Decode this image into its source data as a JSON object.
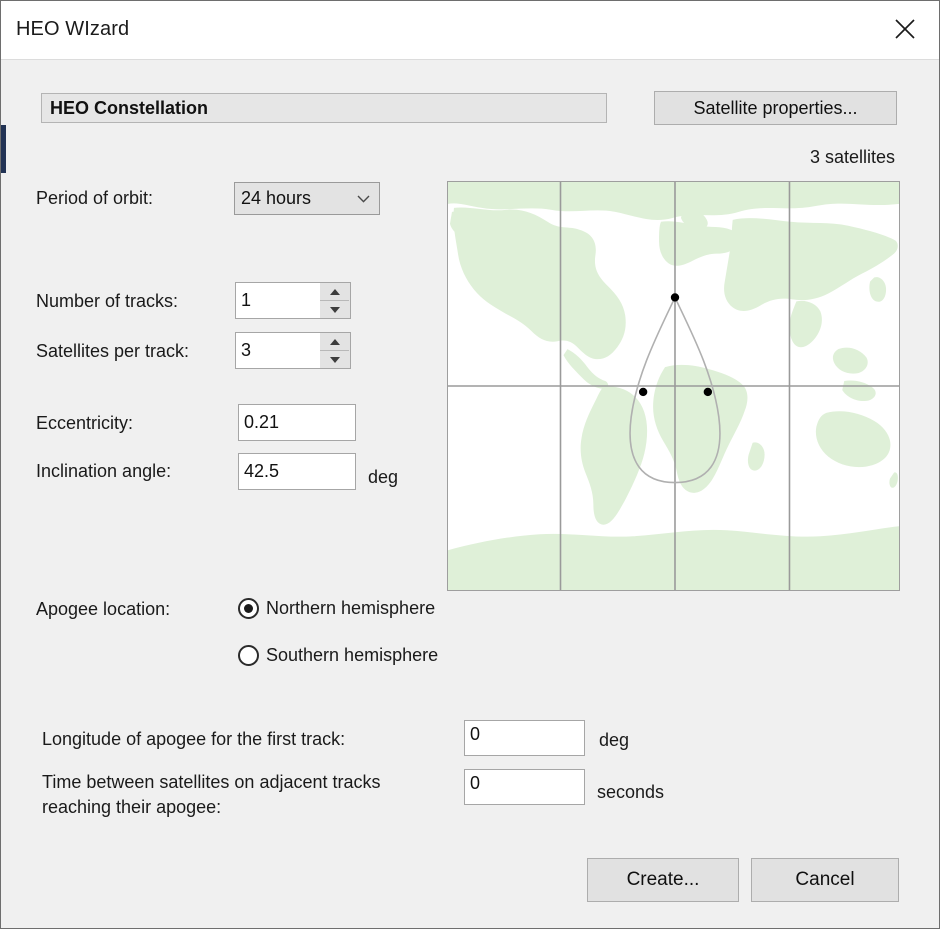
{
  "window": {
    "title": "HEO WIzard",
    "close_icon": "close-icon"
  },
  "header": {
    "section_title": "HEO Constellation",
    "satellite_properties_label": "Satellite properties..."
  },
  "form": {
    "period": {
      "label": "Period of orbit:",
      "value": "24 hours",
      "chevron_icon": "chevron-down-icon",
      "options": [
        "24 hours"
      ]
    },
    "number_of_tracks": {
      "label": "Number of tracks:",
      "value": "1"
    },
    "satellites_per_track": {
      "label": "Satellites per track:",
      "value": "3"
    },
    "eccentricity": {
      "label": "Eccentricity:",
      "value": "0.21"
    },
    "inclination_angle": {
      "label": "Inclination angle:",
      "value": "42.5",
      "unit": "deg"
    },
    "apogee_location": {
      "label": "Apogee location:",
      "options": [
        {
          "label": "Northern hemisphere",
          "selected": true
        },
        {
          "label": "Southern hemisphere",
          "selected": false
        }
      ]
    },
    "longitude_of_apogee": {
      "label": "Longitude of apogee for the first track:",
      "value": "0",
      "unit": "deg"
    },
    "time_between_satellites": {
      "label_line1": "Time between satellites on adjacent tracks",
      "label_line2": "reaching their apogee:",
      "value": "0",
      "unit": "seconds"
    }
  },
  "map": {
    "satellite_count_label": "3 satellites",
    "land_color": "#dff0d8",
    "grid_color": "#9a9a9a",
    "track_color": "#b0b0b0",
    "satellite_color": "#000000"
  },
  "footer": {
    "create_label": "Create...",
    "cancel_label": "Cancel"
  }
}
